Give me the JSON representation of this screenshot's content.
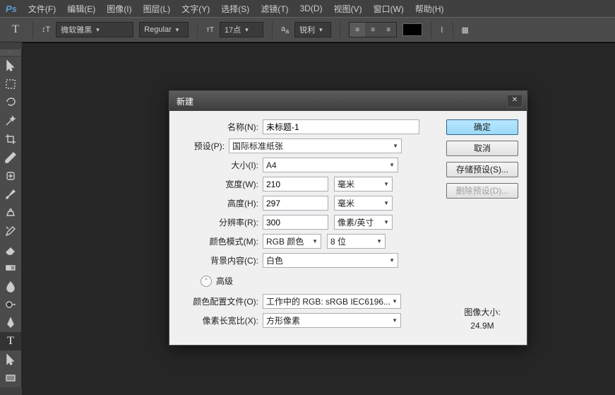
{
  "menu": {
    "items": [
      "文件(F)",
      "编辑(E)",
      "图像(I)",
      "图层(L)",
      "文字(Y)",
      "选择(S)",
      "滤镜(T)",
      "3D(D)",
      "视图(V)",
      "窗口(W)",
      "帮助(H)"
    ]
  },
  "options": {
    "font": "微软雅黑",
    "weight": "Regular",
    "size": "17点",
    "aa": "锐利"
  },
  "dialog": {
    "title": "新建",
    "labels": {
      "name": "名称(N):",
      "preset": "预设(P):",
      "size": "大小(I):",
      "width": "宽度(W):",
      "height": "高度(H):",
      "resolution": "分辨率(R):",
      "colorMode": "颜色模式(M):",
      "background": "背景内容(C):",
      "advanced": "高级",
      "profile": "颜色配置文件(O):",
      "aspect": "像素长宽比(X):",
      "imgSizeLabel": "图像大小:"
    },
    "values": {
      "name": "未标题-1",
      "preset": "国际标准纸张",
      "size": "A4",
      "width": "210",
      "widthUnit": "毫米",
      "height": "297",
      "heightUnit": "毫米",
      "resolution": "300",
      "resUnit": "像素/英寸",
      "colorMode": "RGB 颜色",
      "bitDepth": "8 位",
      "background": "白色",
      "profile": "工作中的 RGB: sRGB IEC6196...",
      "aspect": "方形像素",
      "imgSize": "24.9M"
    },
    "buttons": {
      "ok": "确定",
      "cancel": "取消",
      "save": "存储预设(S)...",
      "delete": "删除预设(D)..."
    }
  }
}
